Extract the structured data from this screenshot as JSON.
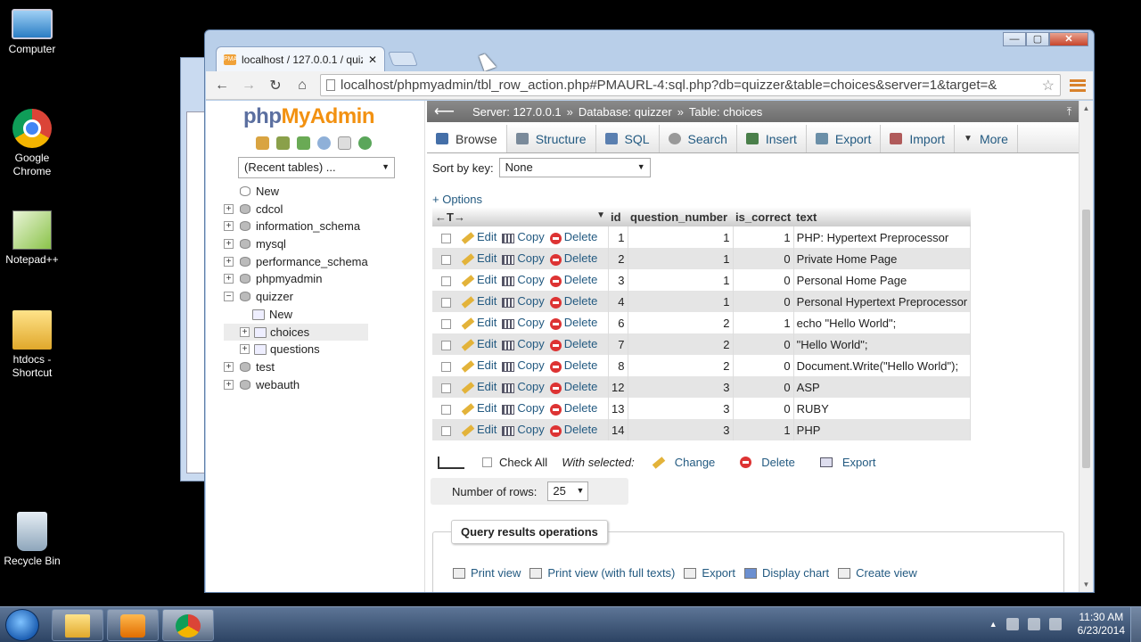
{
  "desktop": {
    "icons": [
      {
        "label": "Computer",
        "icon": "computer-icon"
      },
      {
        "label": "Google Chrome",
        "icon": "chrome-icon"
      },
      {
        "label": "Notepad++",
        "icon": "notepad-icon"
      },
      {
        "label": "htdocs - Shortcut",
        "icon": "folder-shortcut-icon"
      },
      {
        "label": "Recycle Bin",
        "icon": "recycle-bin-icon"
      }
    ]
  },
  "browser": {
    "tab_title": "localhost / 127.0.0.1 / quiz",
    "tab_close": "✕",
    "window_controls": {
      "minimize": "—",
      "maximize": "▢",
      "close": "✕"
    },
    "nav": {
      "back": "←",
      "forward": "→",
      "reload": "↻",
      "home": "⌂",
      "star": "☆"
    },
    "url": "localhost/phpmyadmin/tbl_row_action.php#PMAURL-4:sql.php?db=quizzer&table=choices&server=1&target=&"
  },
  "pma": {
    "logo_php": "php",
    "logo_myadmin": "MyAdmin",
    "recent_tables": "(Recent tables) ...",
    "tree": [
      {
        "label": "New",
        "expander": ""
      },
      {
        "label": "cdcol",
        "expander": "+"
      },
      {
        "label": "information_schema",
        "expander": "+"
      },
      {
        "label": "mysql",
        "expander": "+"
      },
      {
        "label": "performance_schema",
        "expander": "+"
      },
      {
        "label": "phpmyadmin",
        "expander": "+"
      },
      {
        "label": "quizzer",
        "expander": "−"
      }
    ],
    "quizzer_children": [
      {
        "label": "New",
        "expander": ""
      },
      {
        "label": "choices",
        "expander": "+"
      },
      {
        "label": "questions",
        "expander": "+"
      }
    ],
    "tree_after": [
      {
        "label": "test",
        "expander": "+"
      },
      {
        "label": "webauth",
        "expander": "+"
      }
    ],
    "breadcrumb": {
      "back_arrow": "⟵",
      "server": "Server: 127.0.0.1",
      "database": "Database: quizzer",
      "table": "Table: choices",
      "sep": "»",
      "collapse": "⤒"
    },
    "tabs": [
      "Browse",
      "Structure",
      "SQL",
      "Search",
      "Insert",
      "Export",
      "Import",
      "More"
    ],
    "sort_by_key_label": "Sort by key:",
    "sort_by_key_value": "None",
    "options_link": "+ Options",
    "columns": {
      "arrows": "←T→",
      "sort": "▼",
      "id": "id",
      "question_number": "question_number",
      "is_correct": "is_correct",
      "text": "text"
    },
    "row_actions": {
      "edit": "Edit",
      "copy": "Copy",
      "delete": "Delete"
    },
    "rows": [
      {
        "id": "1",
        "question_number": "1",
        "is_correct": "1",
        "text": "PHP: Hypertext Preprocessor"
      },
      {
        "id": "2",
        "question_number": "1",
        "is_correct": "0",
        "text": "Private Home Page"
      },
      {
        "id": "3",
        "question_number": "1",
        "is_correct": "0",
        "text": "Personal Home Page"
      },
      {
        "id": "4",
        "question_number": "1",
        "is_correct": "0",
        "text": "Personal Hypertext Preprocessor"
      },
      {
        "id": "6",
        "question_number": "2",
        "is_correct": "1",
        "text": "echo \"Hello World\";"
      },
      {
        "id": "7",
        "question_number": "2",
        "is_correct": "0",
        "text": "\"Hello World\";"
      },
      {
        "id": "8",
        "question_number": "2",
        "is_correct": "0",
        "text": "Document.Write(\"Hello World\");"
      },
      {
        "id": "12",
        "question_number": "3",
        "is_correct": "0",
        "text": "ASP"
      },
      {
        "id": "13",
        "question_number": "3",
        "is_correct": "0",
        "text": "RUBY"
      },
      {
        "id": "14",
        "question_number": "3",
        "is_correct": "1",
        "text": "PHP"
      }
    ],
    "check_all": "Check All",
    "with_selected": "With selected:",
    "bulk": {
      "change": "Change",
      "delete": "Delete",
      "export": "Export"
    },
    "number_of_rows_label": "Number of rows:",
    "number_of_rows_value": "25",
    "query_results_operations": "Query results operations",
    "qro_links": [
      "Print view",
      "Print view (with full texts)",
      "Export",
      "Display chart",
      "Create view"
    ]
  },
  "taskbar": {
    "time": "11:30 AM",
    "date": "6/23/2014"
  },
  "colors": {
    "link": "#235a81",
    "logo_php": "#5b6fa0",
    "logo_myadmin": "#f29111"
  }
}
